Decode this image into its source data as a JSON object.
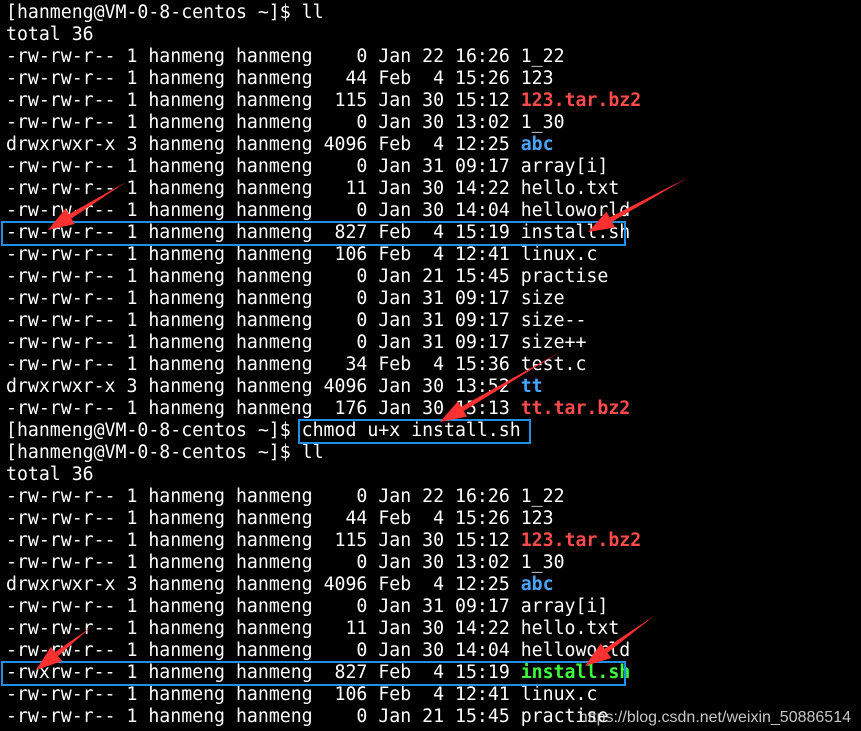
{
  "terminal": {
    "lines": [
      {
        "kind": "prompt",
        "prompt": "[hanmeng@VM-0-8-centos ~]$ ",
        "command": "ll"
      },
      {
        "kind": "text",
        "text": "total 36"
      },
      {
        "kind": "file",
        "perm": "-rw-rw-r--",
        "links": "1",
        "user": "hanmeng",
        "group": "hanmeng",
        "size": "0",
        "month": "Jan",
        "day": "22",
        "time": "16:26",
        "name": "1_22",
        "color": "default"
      },
      {
        "kind": "file",
        "perm": "-rw-rw-r--",
        "links": "1",
        "user": "hanmeng",
        "group": "hanmeng",
        "size": "44",
        "month": "Feb",
        "day": "4",
        "time": "15:26",
        "name": "123",
        "color": "default"
      },
      {
        "kind": "file",
        "perm": "-rw-rw-r--",
        "links": "1",
        "user": "hanmeng",
        "group": "hanmeng",
        "size": "115",
        "month": "Jan",
        "day": "30",
        "time": "15:12",
        "name": "123.tar.bz2",
        "color": "red"
      },
      {
        "kind": "file",
        "perm": "-rw-rw-r--",
        "links": "1",
        "user": "hanmeng",
        "group": "hanmeng",
        "size": "0",
        "month": "Jan",
        "day": "30",
        "time": "13:02",
        "name": "1_30",
        "color": "default"
      },
      {
        "kind": "file",
        "perm": "drwxrwxr-x",
        "links": "3",
        "user": "hanmeng",
        "group": "hanmeng",
        "size": "4096",
        "month": "Feb",
        "day": "4",
        "time": "12:25",
        "name": "abc",
        "color": "blue"
      },
      {
        "kind": "file",
        "perm": "-rw-rw-r--",
        "links": "1",
        "user": "hanmeng",
        "group": "hanmeng",
        "size": "0",
        "month": "Jan",
        "day": "31",
        "time": "09:17",
        "name": "array[i]",
        "color": "default"
      },
      {
        "kind": "file",
        "perm": "-rw-rw-r--",
        "links": "1",
        "user": "hanmeng",
        "group": "hanmeng",
        "size": "11",
        "month": "Jan",
        "day": "30",
        "time": "14:22",
        "name": "hello.txt",
        "color": "default"
      },
      {
        "kind": "file",
        "perm": "-rw-rw-r--",
        "links": "1",
        "user": "hanmeng",
        "group": "hanmeng",
        "size": "0",
        "month": "Jan",
        "day": "30",
        "time": "14:04",
        "name": "helloworld",
        "color": "default"
      },
      {
        "kind": "file",
        "perm": "-rw-rw-r--",
        "links": "1",
        "user": "hanmeng",
        "group": "hanmeng",
        "size": "827",
        "month": "Feb",
        "day": "4",
        "time": "15:19",
        "name": "install.sh",
        "color": "default",
        "highlight": true
      },
      {
        "kind": "file",
        "perm": "-rw-rw-r--",
        "links": "1",
        "user": "hanmeng",
        "group": "hanmeng",
        "size": "106",
        "month": "Feb",
        "day": "4",
        "time": "12:41",
        "name": "linux.c",
        "color": "default"
      },
      {
        "kind": "file",
        "perm": "-rw-rw-r--",
        "links": "1",
        "user": "hanmeng",
        "group": "hanmeng",
        "size": "0",
        "month": "Jan",
        "day": "21",
        "time": "15:45",
        "name": "practise",
        "color": "default"
      },
      {
        "kind": "file",
        "perm": "-rw-rw-r--",
        "links": "1",
        "user": "hanmeng",
        "group": "hanmeng",
        "size": "0",
        "month": "Jan",
        "day": "31",
        "time": "09:17",
        "name": "size",
        "color": "default"
      },
      {
        "kind": "file",
        "perm": "-rw-rw-r--",
        "links": "1",
        "user": "hanmeng",
        "group": "hanmeng",
        "size": "0",
        "month": "Jan",
        "day": "31",
        "time": "09:17",
        "name": "size--",
        "color": "default"
      },
      {
        "kind": "file",
        "perm": "-rw-rw-r--",
        "links": "1",
        "user": "hanmeng",
        "group": "hanmeng",
        "size": "0",
        "month": "Jan",
        "day": "31",
        "time": "09:17",
        "name": "size++",
        "color": "default"
      },
      {
        "kind": "file",
        "perm": "-rw-rw-r--",
        "links": "1",
        "user": "hanmeng",
        "group": "hanmeng",
        "size": "34",
        "month": "Feb",
        "day": "4",
        "time": "15:36",
        "name": "test.c",
        "color": "default"
      },
      {
        "kind": "file",
        "perm": "drwxrwxr-x",
        "links": "3",
        "user": "hanmeng",
        "group": "hanmeng",
        "size": "4096",
        "month": "Jan",
        "day": "30",
        "time": "13:52",
        "name": "tt",
        "color": "blue"
      },
      {
        "kind": "file",
        "perm": "-rw-rw-r--",
        "links": "1",
        "user": "hanmeng",
        "group": "hanmeng",
        "size": "176",
        "month": "Jan",
        "day": "30",
        "time": "15:13",
        "name": "tt.tar.bz2",
        "color": "red"
      },
      {
        "kind": "prompt",
        "prompt": "[hanmeng@VM-0-8-centos ~]$ ",
        "command": "chmod u+x install.sh",
        "highlight_command": true
      },
      {
        "kind": "prompt",
        "prompt": "[hanmeng@VM-0-8-centos ~]$ ",
        "command": "ll"
      },
      {
        "kind": "text",
        "text": "total 36"
      },
      {
        "kind": "file",
        "perm": "-rw-rw-r--",
        "links": "1",
        "user": "hanmeng",
        "group": "hanmeng",
        "size": "0",
        "month": "Jan",
        "day": "22",
        "time": "16:26",
        "name": "1_22",
        "color": "default"
      },
      {
        "kind": "file",
        "perm": "-rw-rw-r--",
        "links": "1",
        "user": "hanmeng",
        "group": "hanmeng",
        "size": "44",
        "month": "Feb",
        "day": "4",
        "time": "15:26",
        "name": "123",
        "color": "default"
      },
      {
        "kind": "file",
        "perm": "-rw-rw-r--",
        "links": "1",
        "user": "hanmeng",
        "group": "hanmeng",
        "size": "115",
        "month": "Jan",
        "day": "30",
        "time": "15:12",
        "name": "123.tar.bz2",
        "color": "red"
      },
      {
        "kind": "file",
        "perm": "-rw-rw-r--",
        "links": "1",
        "user": "hanmeng",
        "group": "hanmeng",
        "size": "0",
        "month": "Jan",
        "day": "30",
        "time": "13:02",
        "name": "1_30",
        "color": "default"
      },
      {
        "kind": "file",
        "perm": "drwxrwxr-x",
        "links": "3",
        "user": "hanmeng",
        "group": "hanmeng",
        "size": "4096",
        "month": "Feb",
        "day": "4",
        "time": "12:25",
        "name": "abc",
        "color": "blue"
      },
      {
        "kind": "file",
        "perm": "-rw-rw-r--",
        "links": "1",
        "user": "hanmeng",
        "group": "hanmeng",
        "size": "0",
        "month": "Jan",
        "day": "31",
        "time": "09:17",
        "name": "array[i]",
        "color": "default"
      },
      {
        "kind": "file",
        "perm": "-rw-rw-r--",
        "links": "1",
        "user": "hanmeng",
        "group": "hanmeng",
        "size": "11",
        "month": "Jan",
        "day": "30",
        "time": "14:22",
        "name": "hello.txt",
        "color": "default"
      },
      {
        "kind": "file",
        "perm": "-rw-rw-r--",
        "links": "1",
        "user": "hanmeng",
        "group": "hanmeng",
        "size": "0",
        "month": "Jan",
        "day": "30",
        "time": "14:04",
        "name": "helloworld",
        "color": "default"
      },
      {
        "kind": "file",
        "perm": "-rwxrw-r--",
        "links": "1",
        "user": "hanmeng",
        "group": "hanmeng",
        "size": "827",
        "month": "Feb",
        "day": "4",
        "time": "15:19",
        "name": "install.sh",
        "color": "green",
        "highlight": true
      },
      {
        "kind": "file",
        "perm": "-rw-rw-r--",
        "links": "1",
        "user": "hanmeng",
        "group": "hanmeng",
        "size": "106",
        "month": "Feb",
        "day": "4",
        "time": "12:41",
        "name": "linux.c",
        "color": "default"
      },
      {
        "kind": "file",
        "perm": "-rw-rw-r--",
        "links": "1",
        "user": "hanmeng",
        "group": "hanmeng",
        "size": "0",
        "month": "Jan",
        "day": "21",
        "time": "15:45",
        "name": "practise",
        "color": "default"
      }
    ]
  },
  "watermark": "https://blog.csdn.net/weixin_50886514",
  "colors": {
    "background": "#000000",
    "text": "#ffffff",
    "archive": "#ff4b4b",
    "directory": "#47a4ff",
    "executable": "#3cff3c",
    "highlight_box": "#1e90e6",
    "arrow": "#ff3030"
  }
}
